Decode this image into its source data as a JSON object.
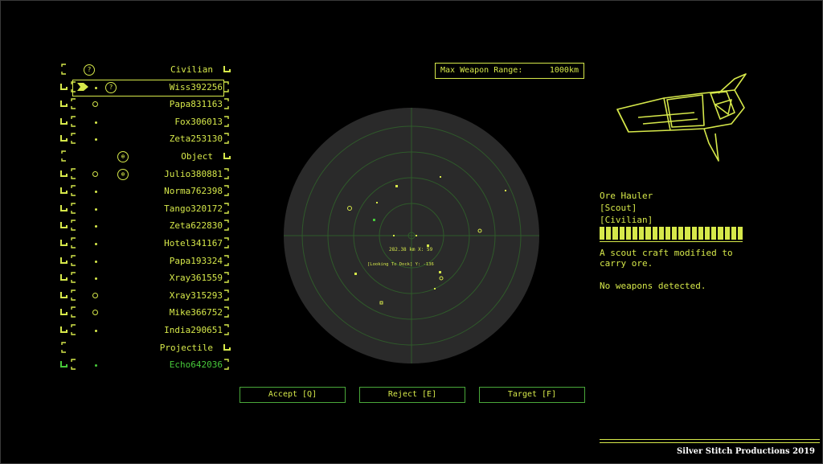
{
  "colors": {
    "accent": "#d6e84a",
    "highlight": "#47c93a",
    "radar_bg": "#2a2a2a",
    "radar_grid": "#2f5a2a"
  },
  "contacts": [
    {
      "kind": "group",
      "name": "Civilian",
      "icon": "question-icon"
    },
    {
      "kind": "contact",
      "name": "Wiss392256",
      "selected": true,
      "icon": "question-icon"
    },
    {
      "kind": "contact",
      "name": "Papa831163"
    },
    {
      "kind": "contact",
      "name": "Fox306013"
    },
    {
      "kind": "contact",
      "name": "Zeta253130"
    },
    {
      "kind": "group",
      "name": "Object",
      "icon": "object-icon"
    },
    {
      "kind": "contact",
      "name": "Julio380881",
      "icon": "object-icon"
    },
    {
      "kind": "contact",
      "name": "Norma762398"
    },
    {
      "kind": "contact",
      "name": "Tango320172"
    },
    {
      "kind": "contact",
      "name": "Zeta622830"
    },
    {
      "kind": "contact",
      "name": "Hotel341167"
    },
    {
      "kind": "contact",
      "name": "Papa193324"
    },
    {
      "kind": "contact",
      "name": "Xray361559"
    },
    {
      "kind": "contact",
      "name": "Xray315293"
    },
    {
      "kind": "contact",
      "name": "Mike366752"
    },
    {
      "kind": "contact",
      "name": "India290651"
    },
    {
      "kind": "group",
      "name": "Projectile"
    },
    {
      "kind": "contact",
      "name": "Echo642036",
      "green": true
    }
  ],
  "range": {
    "label": "Max Weapon Range:",
    "value": "1000km"
  },
  "radar": {
    "readout": "282.38 km X: 59",
    "looking": "[Looking To Dock] Y: -136"
  },
  "buttons": {
    "accept": "Accept [Q]",
    "reject": "Reject [E]",
    "target": "Target [F]"
  },
  "target": {
    "name": "Ore Hauler",
    "class": "[Scout]",
    "faction": "[Civilian]",
    "description": "A scout craft modified to carry ore.",
    "weapons": "No weapons detected.",
    "hull_segments": 22
  },
  "credit": "Silver Stitch Productions 2019"
}
